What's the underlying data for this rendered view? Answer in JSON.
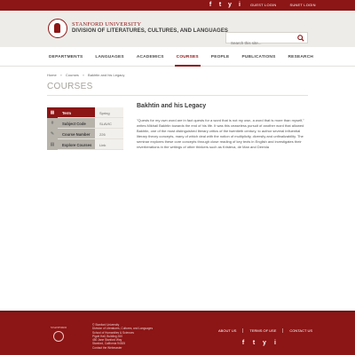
{
  "topbar": {
    "social": [
      "f",
      "t",
      "y",
      "i"
    ],
    "links": [
      "GUEST LOGIN",
      "SUNET LOGIN"
    ]
  },
  "header": {
    "university": "STANFORD UNIVERSITY",
    "division": "DIVISION OF LITERATURES, CULTURES, AND LANGUAGES",
    "search_placeholder": "Search this site..."
  },
  "nav": {
    "items": [
      "DEPARTMENTS",
      "LANGUAGES",
      "ACADEMICS",
      "COURSES",
      "PEOPLE",
      "PUBLICATIONS",
      "RESEARCH"
    ],
    "active": "COURSES"
  },
  "breadcrumb": [
    "Home",
    "Courses",
    "Bakhtin and his Legacy"
  ],
  "page_title": "COURSES",
  "info": [
    {
      "icon": "calendar-icon",
      "glyph": "▦",
      "label": "Term",
      "value": "Spring"
    },
    {
      "icon": "code-icon",
      "glyph": "#",
      "label": "Subject Code",
      "value": "SLAVIC"
    },
    {
      "icon": "number-icon",
      "glyph": "✎",
      "label": "Course Number",
      "value": "226"
    },
    {
      "icon": "explore-icon",
      "glyph": "▤",
      "label": "Explore Courses",
      "value": "Link"
    }
  ],
  "course": {
    "title": "Bakhtin and his Legacy",
    "body": "\"Quests for my own word are in fact quests for a word that is not my own, a word that is more than myself,\" writes Mikhail Bakhtin towards the end of his life. It was this ceaseless pursuit of another word that allowed Bakhtin, one of the most distinguished literary critics of the twentieth century, to author several influential literary theory concepts, many of which deal with the notion of multiplicity, diversity and unfinalizability. The seminar explores these core concepts through close reading of key texts in English and investigates their reverberations in the writings of other thinkers such as Kristeva, de Man and Derrida"
  },
  "footer": {
    "logo_text": "STANFORD",
    "address": [
      "© Stanford University",
      "Division of Literatures, Cultures, and Languages",
      "School of Humanities & Sciences",
      "Pigott Hall, Building 260",
      "450 Jane Stanford Way",
      "Stanford, California 94305",
      "Contact the Webmaster"
    ],
    "links": [
      "ABOUT US",
      "TERMS OF USE",
      "CONTACT US"
    ],
    "social": [
      "f",
      "t",
      "y",
      "i"
    ]
  },
  "colors": {
    "brand": "#8c1515",
    "header_bg": "#eeece8"
  }
}
